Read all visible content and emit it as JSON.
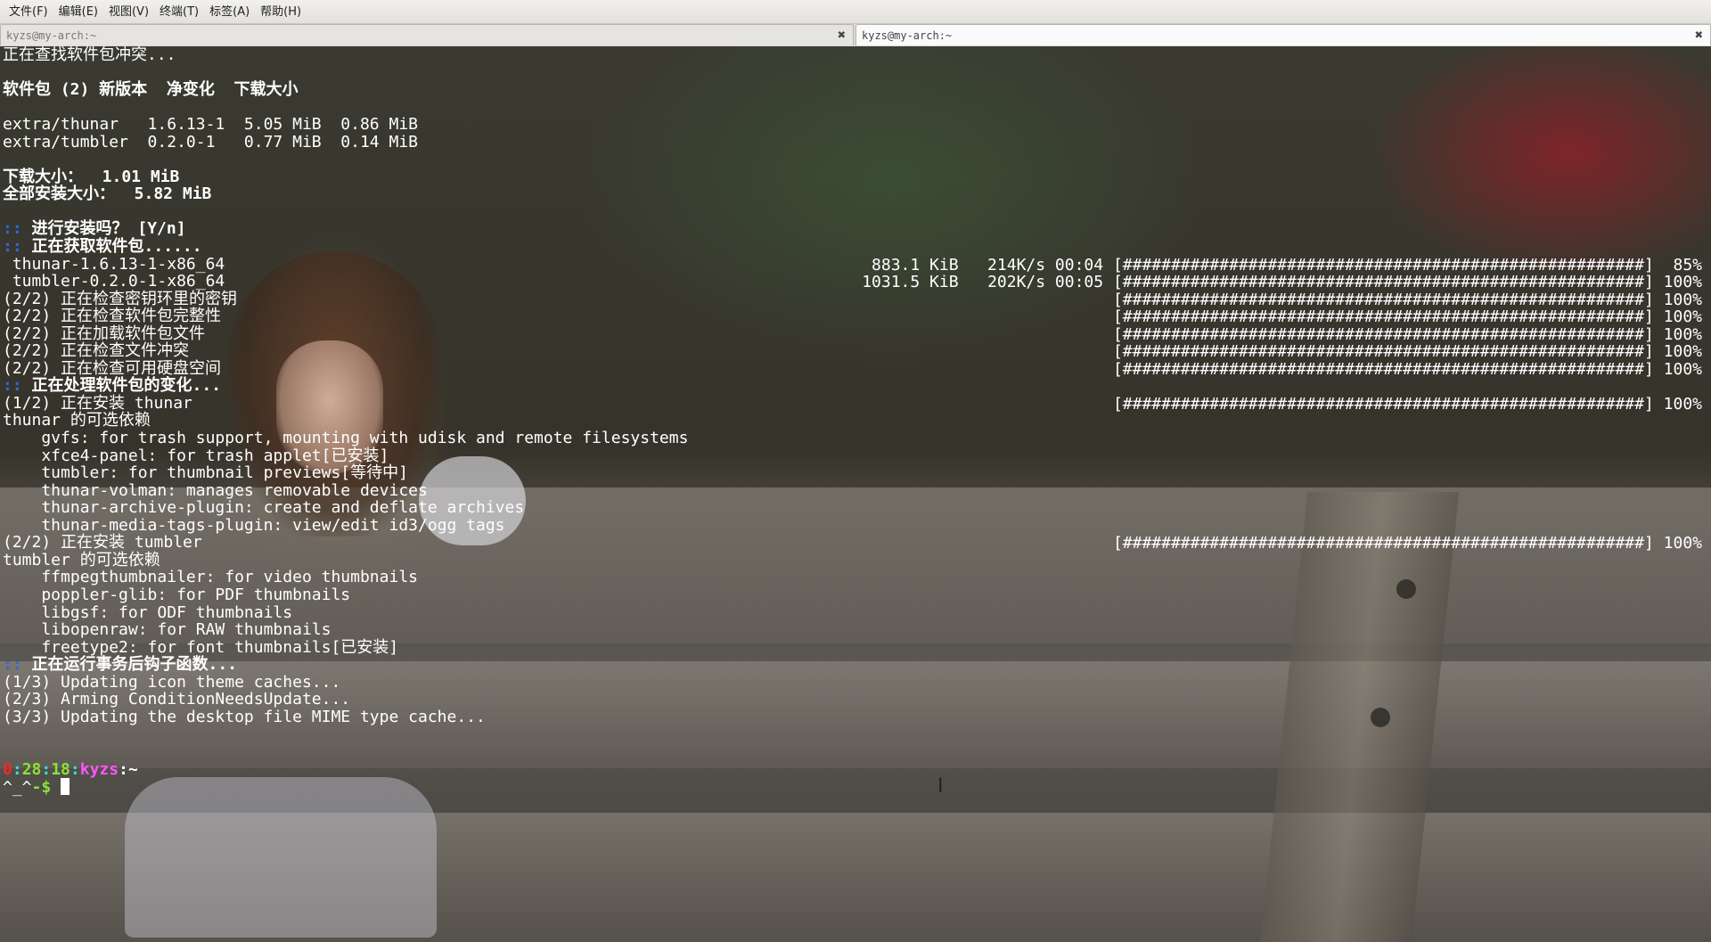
{
  "menu": [
    "文件(F)",
    "编辑(E)",
    "视图(V)",
    "终端(T)",
    "标签(A)",
    "帮助(H)"
  ],
  "tabs": [
    {
      "title": "kyzs@my-arch:~",
      "close": "✖"
    },
    {
      "title": "kyzs@my-arch:~",
      "close": "✖"
    }
  ],
  "terminal": {
    "lines": [
      {
        "text": "正在查找软件包冲突...",
        "style": "normal"
      },
      {
        "text": "",
        "style": "normal"
      },
      {
        "text": "软件包 (2) 新版本  净变化  下载大小",
        "style": "bold"
      },
      {
        "text": "",
        "style": "normal"
      },
      {
        "text": "extra/thunar   1.6.13-1  5.05 MiB  0.86 MiB",
        "style": "normal"
      },
      {
        "text": "extra/tumbler  0.2.0-1   0.77 MiB  0.14 MiB",
        "style": "normal"
      },
      {
        "text": "",
        "style": "normal"
      },
      {
        "text": "下载大小：  1.01 MiB",
        "style": "bold"
      },
      {
        "text": "全部安装大小：  5.82 MiB",
        "style": "bold"
      },
      {
        "text": "",
        "style": "normal"
      },
      {
        "prefix": "::",
        "text": " 进行安装吗？ [Y/n]",
        "style": "bold"
      },
      {
        "prefix": "::",
        "text": " 正在获取软件包......",
        "style": "bold"
      },
      {
        "text": " thunar-1.6.13-1-x86_64",
        "style": "normal",
        "right": "883.1 KiB   214K/s 00:04 [######################################################]  85%"
      },
      {
        "text": " tumbler-0.2.0-1-x86_64",
        "style": "normal",
        "right": "1031.5 KiB   202K/s 00:05 [######################################################] 100%"
      },
      {
        "text": "(2/2) 正在检查密钥环里的密钥",
        "style": "normal",
        "right": "[######################################################] 100%"
      },
      {
        "text": "(2/2) 正在检查软件包完整性",
        "style": "normal",
        "right": "[######################################################] 100%"
      },
      {
        "text": "(2/2) 正在加载软件包文件",
        "style": "normal",
        "right": "[######################################################] 100%"
      },
      {
        "text": "(2/2) 正在检查文件冲突",
        "style": "normal",
        "right": "[######################################################] 100%"
      },
      {
        "text": "(2/2) 正在检查可用硬盘空间",
        "style": "normal",
        "right": "[######################################################] 100%"
      },
      {
        "prefix": "::",
        "text": " 正在处理软件包的变化...",
        "style": "bold"
      },
      {
        "text": "(1/2) 正在安装 thunar",
        "style": "normal",
        "right": "[######################################################] 100%"
      },
      {
        "text": "thunar 的可选依赖",
        "style": "normal"
      },
      {
        "text": "    gvfs: for trash support, mounting with udisk and remote filesystems",
        "style": "normal"
      },
      {
        "text": "    xfce4-panel: for trash applet[已安装]",
        "style": "normal"
      },
      {
        "text": "    tumbler: for thumbnail previews[等待中]",
        "style": "normal"
      },
      {
        "text": "    thunar-volman: manages removable devices",
        "style": "normal"
      },
      {
        "text": "    thunar-archive-plugin: create and deflate archives",
        "style": "normal"
      },
      {
        "text": "    thunar-media-tags-plugin: view/edit id3/ogg tags",
        "style": "normal"
      },
      {
        "text": "(2/2) 正在安装 tumbler",
        "style": "normal",
        "right": "[######################################################] 100%"
      },
      {
        "text": "tumbler 的可选依赖",
        "style": "normal"
      },
      {
        "text": "    ffmpegthumbnailer: for video thumbnails",
        "style": "normal"
      },
      {
        "text": "    poppler-glib: for PDF thumbnails",
        "style": "normal"
      },
      {
        "text": "    libgsf: for ODF thumbnails",
        "style": "normal"
      },
      {
        "text": "    libopenraw: for RAW thumbnails",
        "style": "normal"
      },
      {
        "text": "    freetype2: for font thumbnails[已安装]",
        "style": "normal"
      },
      {
        "prefix": "::",
        "text": " 正在运行事务后钩子函数...",
        "style": "bold"
      },
      {
        "text": "(1/3) Updating icon theme caches...",
        "style": "normal"
      },
      {
        "text": "(2/3) Arming ConditionNeedsUpdate...",
        "style": "normal"
      },
      {
        "text": "(3/3) Updating the desktop file MIME type cache...",
        "style": "normal"
      }
    ],
    "prompt": {
      "hour": "0",
      "sep1": ":",
      "min": "28",
      "sep2": ":",
      "sec": "18",
      "sep3": ":",
      "user": "kyzs",
      "path": ":~",
      "face": "^_^",
      "dollar": "-$ "
    }
  },
  "colors": {
    "prompt_red": "#ef2929",
    "prompt_green": "#8ae234",
    "prompt_cyan": "#34e2e2",
    "prompt_magenta": "#ff55ff",
    "hook_blue": "#3465e4"
  },
  "icons": {
    "tab_close": "close-icon",
    "mouse_cursor": "text-cursor-icon"
  }
}
